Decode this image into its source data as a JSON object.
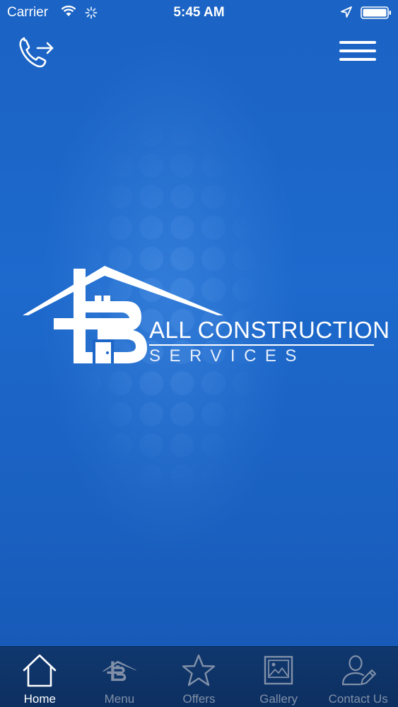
{
  "status_bar": {
    "carrier": "Carrier",
    "time": "5:45 AM",
    "icons": [
      "wifi-icon",
      "activity-icon",
      "location-icon",
      "battery-icon"
    ]
  },
  "header": {
    "left_icon": "call-forward-icon",
    "right_icon": "hamburger-menu-icon"
  },
  "brand": {
    "name": "ALL CONSTRUCTION",
    "subtitle": "SERVICES"
  },
  "tab_bar": {
    "active": "Home",
    "tabs": [
      {
        "label": "Home",
        "icon": "home-icon"
      },
      {
        "label": "Menu",
        "icon": "menu-logo-icon"
      },
      {
        "label": "Offers",
        "icon": "star-icon"
      },
      {
        "label": "Gallery",
        "icon": "gallery-icon"
      },
      {
        "label": "Contact Us",
        "icon": "contact-icon"
      }
    ]
  },
  "colors": {
    "background": "#1b63c4",
    "tab_bar": "#0f3568",
    "tab_inactive": "#8190a8",
    "tab_active": "#ffffff"
  }
}
